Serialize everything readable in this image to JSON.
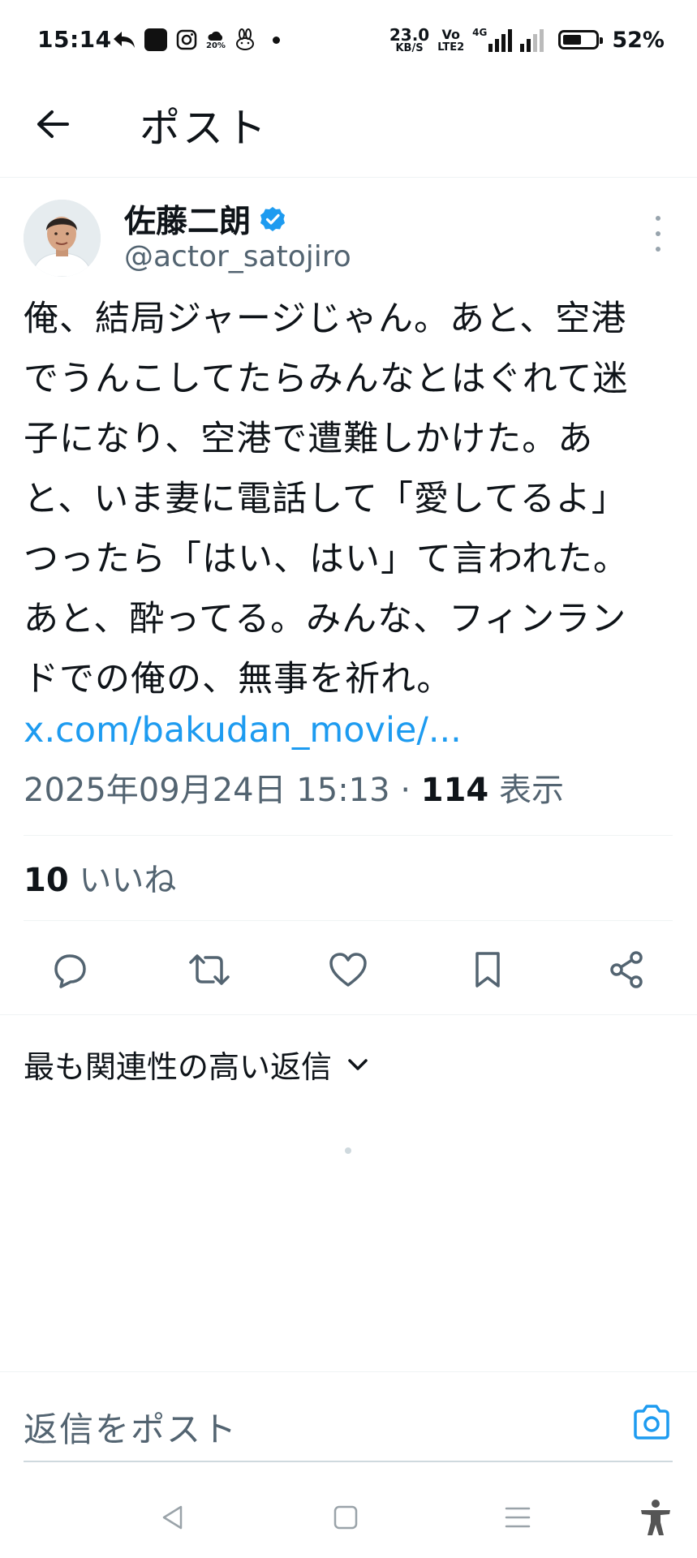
{
  "status_bar": {
    "time": "15:14",
    "speed_value": "23.0",
    "speed_unit": "KB/S",
    "volte_top": "Vo",
    "volte_bottom": "LTE2",
    "network": "4G",
    "weather_percent": "20%",
    "battery_percent": "52%",
    "battery_level": 0.52
  },
  "header": {
    "title": "ポスト",
    "back_icon": "arrow-left-icon"
  },
  "post": {
    "author_name": "佐藤二朗",
    "author_handle": "@actor_satojiro",
    "verified": true,
    "text": "俺、結局ジャージじゃん。あと、空港\nでうんこしてたらみんなとはぐれて迷\n子になり、空港で遭難しかけた。あ\nと、いま妻に電話して「愛してるよ」\nつったら「はい、はい」て言われた。\nあと、酔ってる。みんな、フィンラン\nドでの俺の、無事を祈れ。",
    "link": "x.com/bakudan_movie/...",
    "timestamp": "2025年09月24日 15:13",
    "separator": "·",
    "views_count": "114",
    "views_label": "表示",
    "likes_count": "10",
    "likes_label": "いいね"
  },
  "actions": [
    "reply-icon",
    "repost-icon",
    "like-icon",
    "bookmark-icon",
    "share-icon"
  ],
  "replies_sort": {
    "label": "最も関連性の高い返信"
  },
  "compose": {
    "placeholder": "返信をポスト"
  },
  "colors": {
    "accent": "#1d9bf0",
    "text": "#0f1419",
    "secondary": "#536471"
  }
}
